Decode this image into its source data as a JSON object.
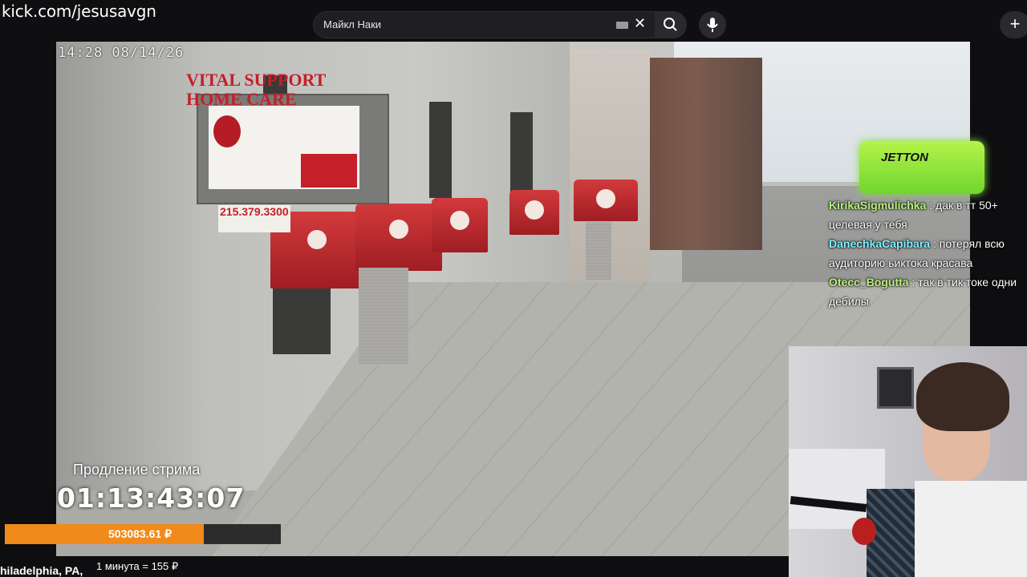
{
  "browser": {
    "url": "kick.com/jesusavgn",
    "search_value": "Майкл Наки"
  },
  "icons": {
    "keyboard": "keyboard-icon",
    "clear": "close-icon",
    "search": "search-icon",
    "mic": "microphone-icon",
    "new": "plus-icon"
  },
  "video": {
    "timestamp": "14:28  08/14/26",
    "sign_title": "VITAL SUPPORT HOME CARE",
    "phone": "215.379.3300"
  },
  "sponsor": {
    "label": "JETTON"
  },
  "chat": [
    {
      "user": "KirikaSigmulichka",
      "text": ": дак в тт 50+ целевая у тебя",
      "color": "#b9f27c"
    },
    {
      "user": "DanechkaCapibara",
      "text": ": потерял всю аудиторию ьиктока красава",
      "color": "#7ff0ff"
    },
    {
      "user": "Otecc_Bogutta",
      "text": ": так в тик токе одни дебилы",
      "color": "#b9f27c"
    }
  ],
  "stream": {
    "extension_label": "Продление стрима",
    "timer": "01:13:43:07",
    "amount": "503083.61 ₽",
    "progress": 0.72,
    "location": "hiladelphia, PA,",
    "rate": "1 минута = 155 ₽"
  },
  "colors": {
    "progress": "#f08a1b",
    "sponsor": "#8be23a"
  }
}
